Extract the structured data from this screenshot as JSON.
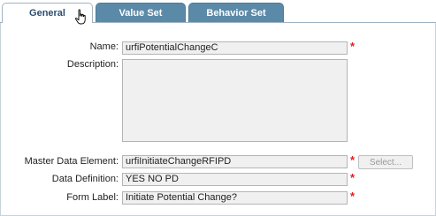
{
  "tabs": [
    {
      "label": "General",
      "active": true
    },
    {
      "label": "Value Set",
      "active": false
    },
    {
      "label": "Behavior Set",
      "active": false
    }
  ],
  "form": {
    "name": {
      "label": "Name:",
      "value": "urfiPotentialChangeC",
      "required": "*"
    },
    "description": {
      "label": "Description:",
      "value": ""
    },
    "master_data_element": {
      "label": "Master Data Element:",
      "value": "urfiInitiateChangeRFIPD",
      "required": "*",
      "button_label": "Select..."
    },
    "data_definition": {
      "label": "Data Definition:",
      "value": "YES NO PD",
      "required": "*"
    },
    "form_label": {
      "label": "Form Label:",
      "value": "Initiate Potential Change?",
      "required": "*"
    }
  },
  "colors": {
    "active_tab_text": "#2b4e72",
    "inactive_tab_bg": "#5b8aa8",
    "required_marker": "#e02020",
    "field_bg": "#f0f0f0"
  },
  "icons": {
    "cursor": "hand-pointer-icon"
  }
}
